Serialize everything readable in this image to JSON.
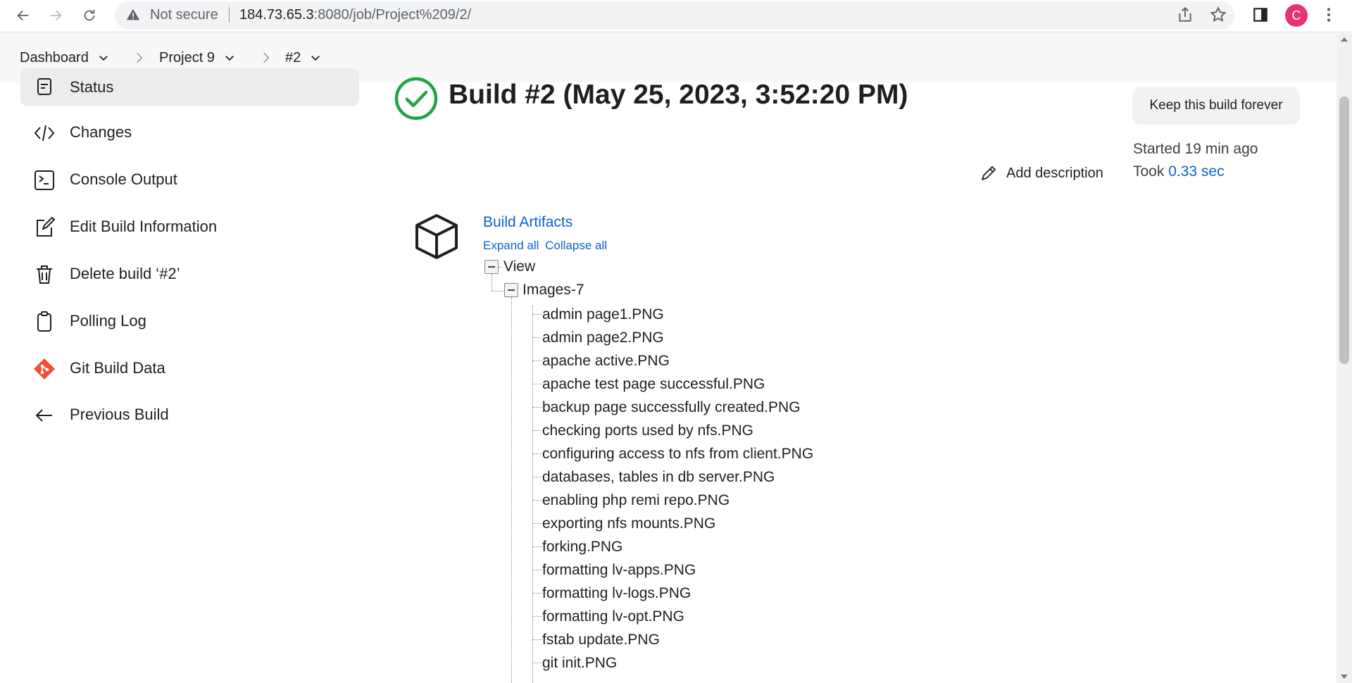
{
  "browser": {
    "security_label": "Not secure",
    "url_host": "184.73.65.3",
    "url_rest": ":8080/job/Project%209/2/",
    "avatar_letter": "C",
    "avatar_color": "#e8336d"
  },
  "breadcrumb": [
    {
      "label": "Dashboard"
    },
    {
      "label": "Project 9"
    },
    {
      "label": "#2"
    }
  ],
  "sidebar": {
    "items": [
      {
        "label": "Status",
        "icon": "status-icon",
        "active": true
      },
      {
        "label": "Changes",
        "icon": "code-icon"
      },
      {
        "label": "Console Output",
        "icon": "terminal-icon"
      },
      {
        "label": "Edit Build Information",
        "icon": "edit-icon"
      },
      {
        "label": "Delete build ‘#2’",
        "icon": "trash-icon"
      },
      {
        "label": "Polling Log",
        "icon": "clipboard-icon"
      },
      {
        "label": "Git Build Data",
        "icon": "git-icon"
      },
      {
        "label": "Previous Build",
        "icon": "arrow-left-icon"
      }
    ]
  },
  "build": {
    "title": "Build #2 (May 25, 2023, 3:52:20 PM)",
    "status_color": "#1ea446",
    "keep_label": "Keep this build forever",
    "started": "Started 19 min ago",
    "took_prefix": "Took ",
    "took_value": "0.33 sec",
    "add_description": "Add description"
  },
  "artifacts": {
    "title": "Build Artifacts",
    "expand_all": "Expand all",
    "collapse_all": "Collapse all",
    "root": "View",
    "folder": "Images-7",
    "files": [
      "admin page1.PNG",
      "admin page2.PNG",
      "apache active.PNG",
      "apache test page successful.PNG",
      "backup page successfully created.PNG",
      "checking ports used by nfs.PNG",
      "configuring access to nfs from client.PNG",
      "databases, tables in db server.PNG",
      "enabling php remi repo.PNG",
      "exporting nfs mounts.PNG",
      "forking.PNG",
      "formatting lv-apps.PNG",
      "formatting lv-logs.PNG",
      "formatting lv-opt.PNG",
      "fstab update.PNG",
      "git init.PNG"
    ]
  },
  "colors": {
    "link": "#0b63c9",
    "accent_git": "#f05133"
  }
}
